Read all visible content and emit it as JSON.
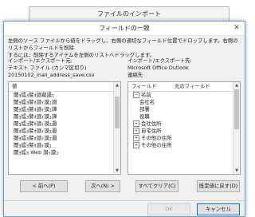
{
  "bg_window": {
    "title": "ファイルのインポート"
  },
  "dialog": {
    "title": "フィールドの一致",
    "close_glyph": "✕",
    "instructions": [
      "左側のソース ファイルから値をドラッグし、右側の適切なフィールド位置でドロップします。右側のリストからフィールドを削除",
      "するには、削除するアイテムを左側のリストへドラッグします。"
    ]
  },
  "left": {
    "label": "インポート/エクスポート元:",
    "type": "テキスト ファイル (カンマ区切り)",
    "file": "20150102_mail_address_save.csv",
    "header": "値",
    "items": [
      "閾ｮ繧ｮ譬ｫ譛蔵遏ｭ",
      "閾ｮ繧ｮ譬ｫ譛ｨ謨ｭ譛",
      "閾ｮ繧ｮ譬ｫ譛ｨ謨ｭ譁",
      "閾ｮ繧ｮ譬ｫ譛ｨ謨ｭ譁",
      "閾ｮ繧ｮ譬ｫ譛ｨ謨ｭ遏",
      "閾ｮ繧ｮ譬ｫ譛ｨ謨ｭ遏",
      "閾ｮ繧ｮ譬ｫ譛ｨ謨ｭ遏",
      "閾ｮ繧ｮ譬ｫ譛ｨ謨ｭ",
      "閾ｮ繧ｮ Web 譛ｨ謨ｭ"
    ],
    "prev_button": "< 前へ(P)",
    "next_button": "次へ(N) >"
  },
  "right": {
    "label": "インポート/エクスポート先:",
    "app": "Microsoft Office Outlook",
    "folder": "連絡先",
    "col_field": "フィールド",
    "col_source": "元のフィールド",
    "items": [
      {
        "label": "名前",
        "expander": "⊟",
        "indent": false
      },
      {
        "label": "会社名",
        "expander": "",
        "indent": true
      },
      {
        "label": "部署",
        "expander": "",
        "indent": true
      },
      {
        "label": "役職",
        "expander": "",
        "indent": true
      },
      {
        "label": "会社住所",
        "expander": "⊞",
        "indent": false
      },
      {
        "label": "自宅住所",
        "expander": "⊞",
        "indent": false
      },
      {
        "label": "その他の住所",
        "expander": "⊞",
        "indent": false
      },
      {
        "label": "その他の住所",
        "expander": "⊞",
        "indent": false
      }
    ],
    "clear_button": "すべてクリア(C)",
    "default_button": "既定値に戻す(D)"
  },
  "ok_button": "OK",
  "cancel_button": "キャンセル"
}
